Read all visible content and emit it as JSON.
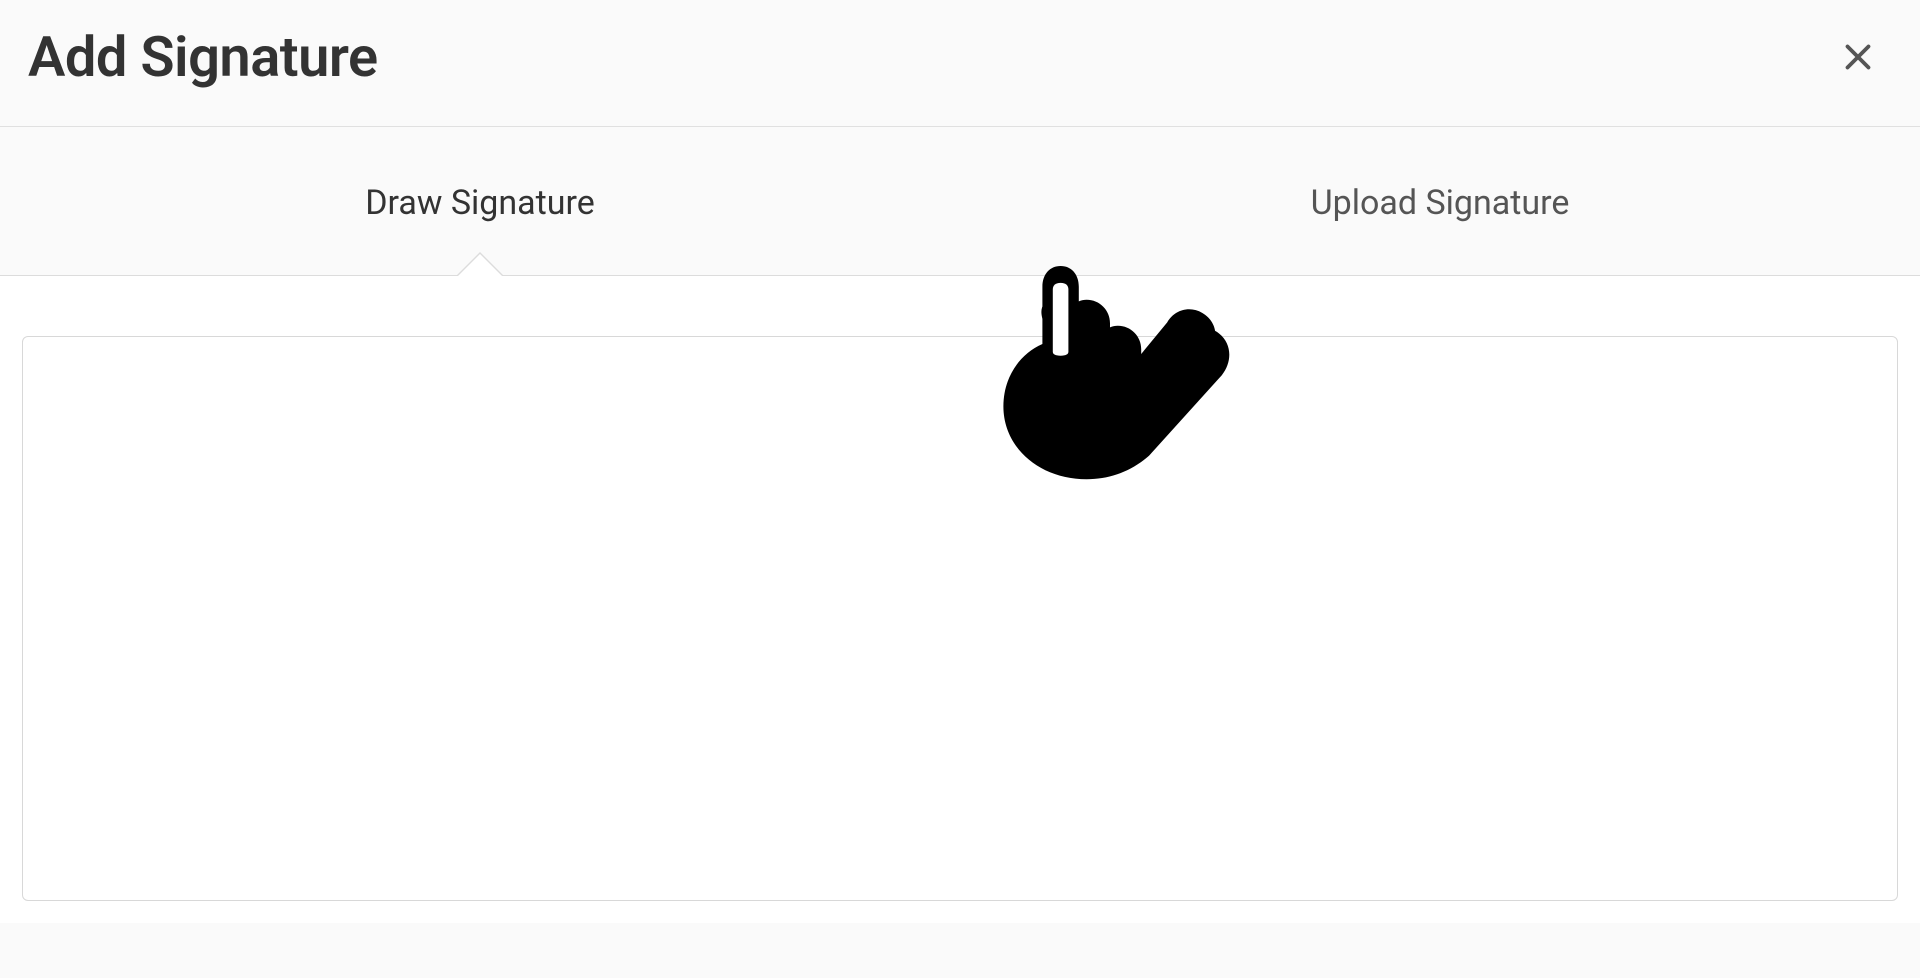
{
  "modal": {
    "title": "Add Signature"
  },
  "tabs": {
    "draw": {
      "label": "Draw Signature"
    },
    "upload": {
      "label": "Upload Signature"
    }
  }
}
